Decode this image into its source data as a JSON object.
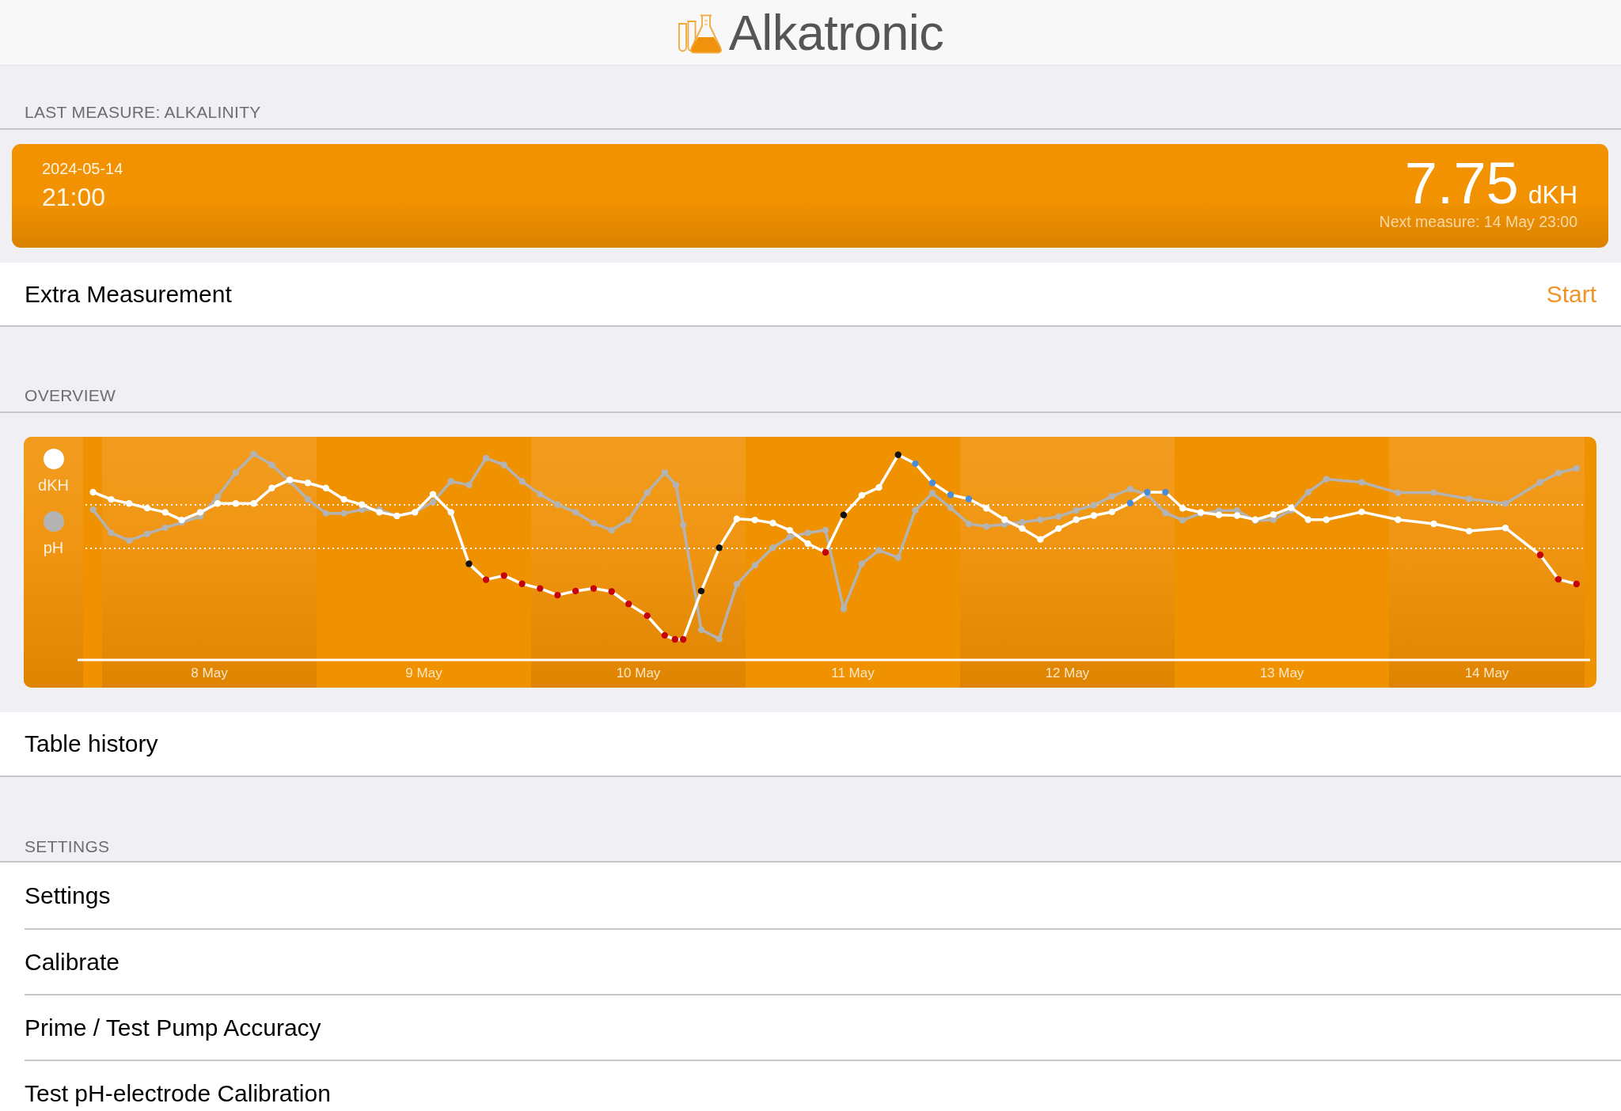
{
  "header": {
    "title": "Alkatronic"
  },
  "last_measure": {
    "section_title": "LAST MEASURE: ALKALINITY",
    "date": "2024-05-14",
    "time": "21:00",
    "value": "7.75",
    "unit": "dKH",
    "next_measure": "Next measure: 14 May 23:00"
  },
  "extra_measurement": {
    "label": "Extra Measurement",
    "action": "Start"
  },
  "overview": {
    "section_title": "OVERVIEW",
    "legend": [
      {
        "label": "dKH",
        "color": "#ffffff"
      },
      {
        "label": "pH",
        "color": "#b3b3b3"
      }
    ],
    "x_labels": [
      "8 May",
      "9 May",
      "10 May",
      "11 May",
      "12 May",
      "13 May",
      "14 May"
    ]
  },
  "table_history": {
    "label": "Table history"
  },
  "settings": {
    "section_title": "SETTINGS",
    "items": [
      "Settings",
      "Calibrate",
      "Prime / Test Pump Accuracy",
      "Test pH-electrode Calibration"
    ]
  }
}
